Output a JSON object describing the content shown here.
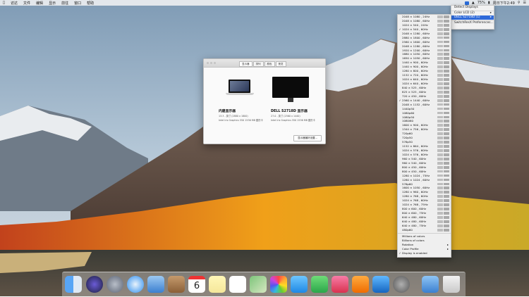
{
  "menubar": {
    "items": [
      "访达",
      "文件",
      "编辑",
      "显示",
      "前往",
      "窗口",
      "帮助"
    ],
    "right_text": "75%",
    "time": "周日下午2:49"
  },
  "display_menu": {
    "items": [
      {
        "label": "Detect Displays"
      },
      {
        "label": "Color LCD (2)",
        "submenu": true
      },
      {
        "label": "DELL S2718D (1)",
        "submenu": true,
        "selected": true
      },
      {
        "label": "SwitchResX Preferences..."
      }
    ]
  },
  "resolutions": [
    "2048 × 1080 , 24Hz",
    "2048 × 1080 , 60Hz",
    "1024 × 540 , 24Hz",
    "1024 × 540 , 60Hz",
    "2048 × 1280 , 60Hz",
    "2880 × 1800 , 60Hz",
    "2560 × 1600 , 60Hz",
    "2048 × 1280 , 60Hz",
    "1920 × 1200 , 60Hz",
    "1680 × 1050 , 60Hz",
    "1650 × 1050 , 60Hz",
    "1440 × 900 , 60Hz",
    "1440 × 900 , 60Hz",
    "1280 × 800 , 60Hz",
    "1152 × 720 , 60Hz",
    "1024 × 640 , 60Hz",
    "1024 × 640 , 60Hz",
    "840 × 525 , 60Hz",
    "825 × 525 , 60Hz",
    "720 × 450 , 60Hz",
    "2560 × 1440 , 60Hz",
    "2048 × 1152 , 60Hz",
    "1440p50",
    "1080p60",
    "1080p50",
    "1080i60",
    "1600 × 900 , 60Hz",
    "1344 × 756 , 60Hz",
    "720p60",
    "720p50",
    "576p50",
    "1152 × 864 , 60Hz",
    "1024 × 576 , 60Hz",
    "1024 × 576 , 60Hz",
    "960 × 540 , 60Hz",
    "960 × 540 , 60Hz",
    "800 × 450 , 60Hz",
    "800 × 450 , 60Hz",
    "1280 × 1024 , 75Hz",
    "1280 × 1024 , 60Hz",
    "576p60",
    "1600 × 1050 , 60Hz",
    "1280 × 960 , 60Hz",
    "1280 × 768 , 60Hz",
    "1024 × 768 , 60Hz",
    "1024 × 768 , 75Hz",
    "800 × 600 , 60Hz",
    "800 × 600 , 75Hz",
    "640 × 480 , 60Hz",
    "640 × 480 , 60Hz",
    "640 × 480 , 75Hz",
    "480p60"
  ],
  "checked_indices": [
    3,
    20
  ],
  "resolution_footer": [
    {
      "label": "Millions of colors"
    },
    {
      "label": "Billions of colors"
    },
    {
      "label": "Rotation",
      "submenu": true
    },
    {
      "label": "Color Profile",
      "submenu": true
    },
    {
      "label": "Display is enabled",
      "check": true
    }
  ],
  "displays_window": {
    "tabs": [
      "显示器",
      "排列",
      "颜色",
      "夜览"
    ],
    "active_tab": 0,
    "builtin_name": "内建显示器",
    "builtin_sub1": "13.3 - 英寸 (2880 x 1800)",
    "builtin_sub2": "Intel Iris Graphics 550 1536 MB 图形卡",
    "dell_name": "DELL S2718D 显示器",
    "dell_sub1": "27.0 - 英寸 (2560 x 1440)",
    "dell_sub2": "Intel Iris Graphics 550 1536 MB 图形卡",
    "gather_button": "显示器偏好设置..."
  },
  "dock": {
    "apps": [
      "finder-icon",
      "siri-icon",
      "launchpad-icon",
      "safari-icon",
      "mail-icon",
      "contacts-icon",
      "calendar-icon",
      "notes-icon",
      "reminders-icon",
      "maps-icon",
      "photos-icon",
      "messages-icon",
      "facetime-icon",
      "music-icon",
      "books-icon",
      "app-store-icon",
      "system-preferences-icon",
      "downloads-icon",
      "trash-icon"
    ],
    "calendar_day": "6"
  },
  "colors": {
    "accent": "#2f6ad9",
    "menu_bg": "#efefef"
  }
}
